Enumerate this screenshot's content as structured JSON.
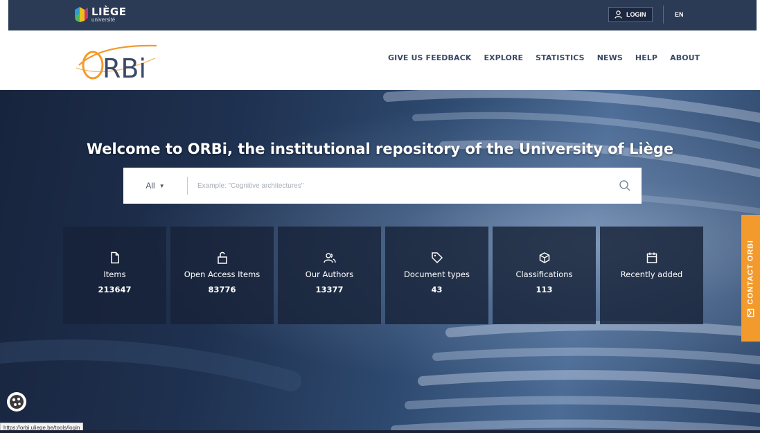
{
  "topbar": {
    "university_name": "LIÈGE",
    "university_sub": "université",
    "login_label": "LOGIN",
    "language_label": "EN"
  },
  "header": {
    "logo_text": "ORBi",
    "nav": [
      {
        "label": "GIVE US FEEDBACK"
      },
      {
        "label": "EXPLORE"
      },
      {
        "label": "STATISTICS"
      },
      {
        "label": "NEWS"
      },
      {
        "label": "HELP"
      },
      {
        "label": "ABOUT"
      }
    ]
  },
  "hero": {
    "title": "Welcome to ORBi, the institutional repository of the University of Liège",
    "search": {
      "scope": "All",
      "placeholder": "Example: \"Cognitive architectures\""
    }
  },
  "stats": [
    {
      "icon": "file-icon",
      "label": "Items",
      "value": "213647"
    },
    {
      "icon": "unlock-icon",
      "label": "Open Access Items",
      "value": "83776"
    },
    {
      "icon": "users-icon",
      "label": "Our Authors",
      "value": "13377"
    },
    {
      "icon": "tag-icon",
      "label": "Document types",
      "value": "43"
    },
    {
      "icon": "cube-icon",
      "label": "Classifications",
      "value": "113"
    },
    {
      "icon": "calendar-icon",
      "label": "Recently added",
      "value": ""
    }
  ],
  "contact_tab": {
    "label": "CONTACT ORBI"
  },
  "status_bar": {
    "url": "https://orbi.uliege.be/tools/login"
  },
  "colors": {
    "topbar": "#2b3a55",
    "nav_text": "#3b4a68",
    "accent_orange": "#f39a2c",
    "stat_tile": "#172238"
  }
}
